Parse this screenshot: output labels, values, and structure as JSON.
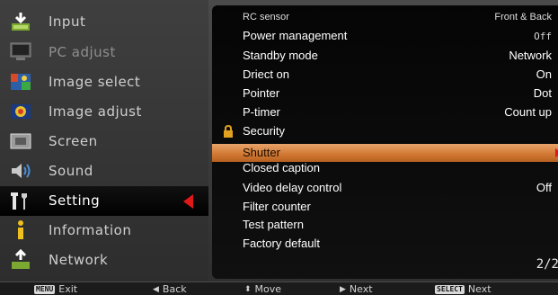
{
  "left_menu": {
    "items": [
      {
        "label": "Input",
        "icon": "input-icon"
      },
      {
        "label": "PC adjust",
        "icon": "pc-adjust-icon"
      },
      {
        "label": "Image select",
        "icon": "image-select-icon"
      },
      {
        "label": "Image adjust",
        "icon": "image-adjust-icon"
      },
      {
        "label": "Screen",
        "icon": "screen-icon"
      },
      {
        "label": "Sound",
        "icon": "sound-icon"
      },
      {
        "label": "Setting",
        "icon": "setting-icon"
      },
      {
        "label": "Information",
        "icon": "information-icon"
      },
      {
        "label": "Network",
        "icon": "network-icon"
      }
    ],
    "active_index": 6
  },
  "settings": {
    "rows": [
      {
        "label": "RC sensor",
        "value": "Front & Back"
      },
      {
        "label": "Power management",
        "value": "Off"
      },
      {
        "label": "Standby mode",
        "value": "Network"
      },
      {
        "label": "Driect on",
        "value": "On"
      },
      {
        "label": "Pointer",
        "value": "Dot"
      },
      {
        "label": "P-timer",
        "value": "Count up"
      },
      {
        "label": "Security",
        "value": ""
      },
      {
        "label": "Shutter",
        "value": ""
      },
      {
        "label": "Closed caption",
        "value": ""
      },
      {
        "label": "Video delay control",
        "value": "Off"
      },
      {
        "label": "Filter counter",
        "value": ""
      },
      {
        "label": "Test pattern",
        "value": ""
      },
      {
        "label": "Factory default",
        "value": ""
      }
    ],
    "highlighted_index": 7,
    "page_indicator": "2/2"
  },
  "bottom_bar": {
    "exit_key": "MENU",
    "exit_label": "Exit",
    "back_glyph": "◀",
    "back_label": "Back",
    "move_glyph": "⬍",
    "move_label": "Move",
    "next_glyph": "▶",
    "next_label": "Next",
    "select_key": "SELECT",
    "select_next_label": "Next"
  },
  "colors": {
    "highlight": "#d27a35",
    "active_arrow": "#e01818",
    "panel_bg": "#0a0a0a"
  }
}
